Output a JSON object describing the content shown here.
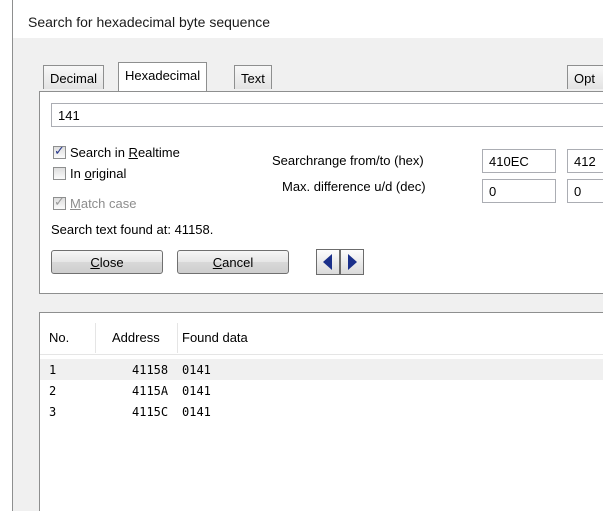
{
  "window": {
    "title": "Search for hexadecimal byte sequence"
  },
  "tabs": [
    {
      "label": "Decimal",
      "active": false
    },
    {
      "label": "Hexadecimal",
      "active": true
    },
    {
      "label": "Text",
      "active": false
    },
    {
      "label": "Opt",
      "active": false
    }
  ],
  "search": {
    "value": "141"
  },
  "options": {
    "realtime": {
      "label_pre": "Search in ",
      "accel": "R",
      "label_post": "ealtime",
      "checked": true
    },
    "in_original": {
      "label_pre": "In ",
      "accel": "o",
      "label_post": "riginal",
      "checked": false
    },
    "match_case": {
      "label_pre": "",
      "accel": "M",
      "label_post": "atch case",
      "checked": true,
      "disabled": true
    }
  },
  "range": {
    "label": "Searchrange from/to (hex)",
    "from": "410EC",
    "to": "412"
  },
  "difference": {
    "label": "Max. difference u/d (dec)",
    "up": "0",
    "down": "0"
  },
  "status": "Search text found at: 41158.",
  "buttons": {
    "close": {
      "accel": "C",
      "rest": "lose"
    },
    "cancel": {
      "accel": "C",
      "rest": "ancel"
    }
  },
  "results": {
    "columns": [
      "No.",
      "Address",
      "Found data"
    ],
    "rows": [
      {
        "no": "1",
        "address": "41158",
        "data": "0141"
      },
      {
        "no": "2",
        "address": "4115A",
        "data": "0141"
      },
      {
        "no": "3",
        "address": "4115C",
        "data": "0141"
      }
    ]
  },
  "icons": {
    "prev": "triangle-left-icon",
    "next": "triangle-right-icon",
    "check": "check-mark-icon"
  },
  "colors": {
    "arrow": "#1a2f8a",
    "selected_row": "#f0f0f0",
    "window_bg": "#f0f0f0"
  }
}
